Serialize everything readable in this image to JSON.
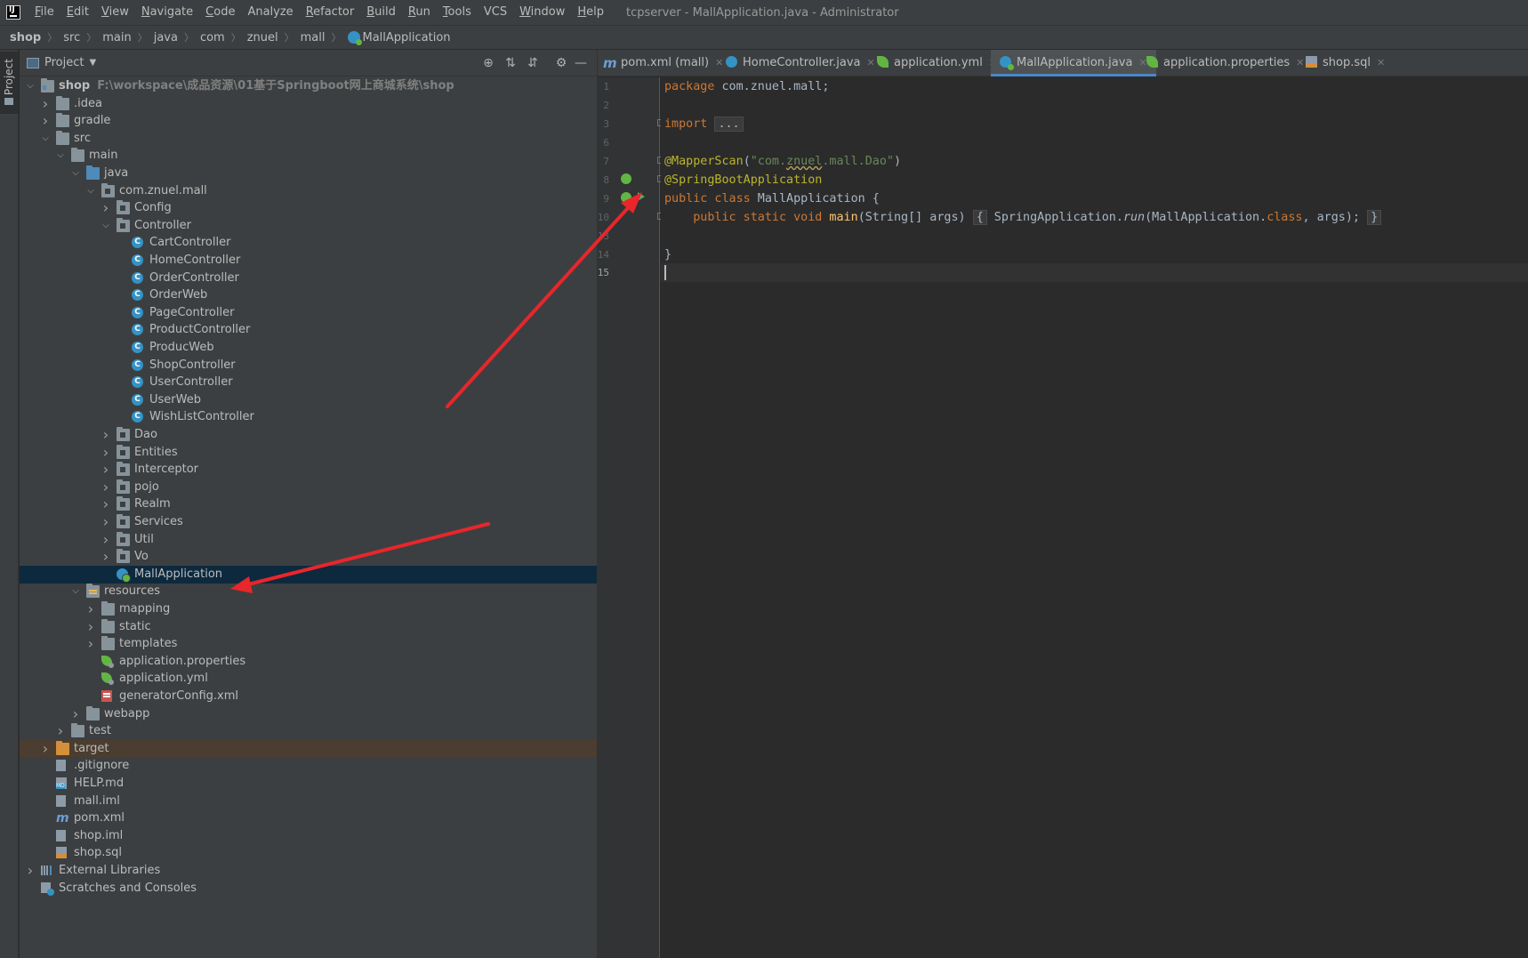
{
  "menubar": {
    "items": [
      "File",
      "Edit",
      "View",
      "Navigate",
      "Code",
      "Analyze",
      "Refactor",
      "Build",
      "Run",
      "Tools",
      "VCS",
      "Window",
      "Help"
    ],
    "window_title": "tcpserver - MallApplication.java - Administrator"
  },
  "breadcrumb": {
    "items": [
      "shop",
      "src",
      "main",
      "java",
      "com",
      "znuel",
      "mall",
      "MallApplication"
    ]
  },
  "tool_stripe": {
    "project_label": "Project"
  },
  "project_panel": {
    "title": "Project",
    "root_hint": "F:\\workspace\\成品资源\\01基于Springboot网上商城系统\\shop",
    "tree": {
      "shop": "shop",
      "idea": ".idea",
      "gradle": "gradle",
      "src": "src",
      "main": "main",
      "java": "java",
      "package": "com.znuel.mall",
      "config": "Config",
      "controller": "Controller",
      "controllers": [
        "CartController",
        "HomeController",
        "OrderController",
        "OrderWeb",
        "PageController",
        "ProductController",
        "ProducWeb",
        "ShopController",
        "UserController",
        "UserWeb",
        "WishListController"
      ],
      "packages": [
        "Dao",
        "Entities",
        "Interceptor",
        "pojo",
        "Realm",
        "Services",
        "Util",
        "Vo"
      ],
      "mall_application": "MallApplication",
      "resources": "resources",
      "res_folders": [
        "mapping",
        "static",
        "templates"
      ],
      "res_files": [
        "application.properties",
        "application.yml",
        "generatorConfig.xml"
      ],
      "webapp": "webapp",
      "test": "test",
      "target": "target",
      "root_files": [
        ".gitignore",
        "HELP.md",
        "mall.iml",
        "pom.xml",
        "shop.iml",
        "shop.sql"
      ],
      "external_libraries": "External Libraries",
      "scratches": "Scratches and Consoles"
    }
  },
  "editor_tabs": [
    {
      "label": "pom.xml (mall)",
      "icon": "maven-icon",
      "active": false
    },
    {
      "label": "HomeController.java",
      "icon": "class-icon",
      "active": false
    },
    {
      "label": "application.yml",
      "icon": "spring-config-icon",
      "active": false
    },
    {
      "label": "MallApplication.java",
      "icon": "spring-boot-class-icon",
      "active": true
    },
    {
      "label": "application.properties",
      "icon": "spring-config-icon",
      "active": false
    },
    {
      "label": "shop.sql",
      "icon": "sql-icon",
      "active": false
    }
  ],
  "gutter": {
    "line_numbers": [
      "1",
      "2",
      "3",
      "6",
      "7",
      "8",
      "9",
      "10",
      "13",
      "14",
      "15"
    ]
  },
  "code": {
    "l1_kw": "package",
    "l1_rest": " com.znuel.mall;",
    "l3_kw": "import",
    "l3_fold": "...",
    "l7_ann": "@MapperScan",
    "l7_p1": "(",
    "l7_str_a": "\"com.",
    "l7_str_b": "znuel",
    "l7_str_c": ".mall.Dao\"",
    "l7_p2": ")",
    "l8_ann": "@SpringBootApplication",
    "l9_kw": "public class",
    "l9_rest": " MallApplication {",
    "l10_indent": "    ",
    "l10_kw": "public static void",
    "l10_fn": " main",
    "l10_args": "(String[] args) ",
    "l10_fold_open": "{",
    "l10_body_a": " SpringApplication.",
    "l10_run": "run",
    "l10_body_b": "(MallApplication.",
    "l10_class_kw": "class",
    "l10_body_c": ", args); ",
    "l10_fold_close": "}",
    "l14": "}"
  },
  "colors": {
    "annotation_arrow": "#e8262b",
    "selection": "#0d293e",
    "accent": "#4a88c7"
  }
}
